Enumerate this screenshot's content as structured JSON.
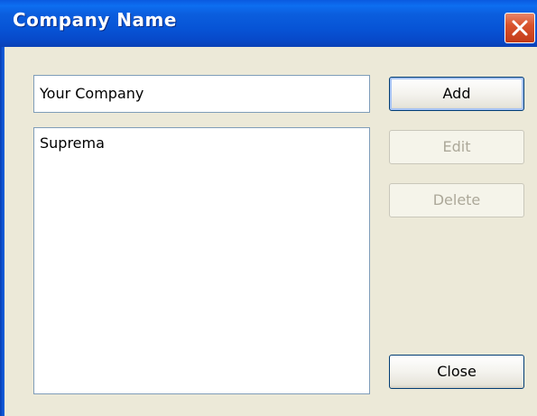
{
  "window": {
    "title": "Company Name",
    "close_icon": "close-icon"
  },
  "input": {
    "value": "Your Company"
  },
  "list": {
    "items": [
      "Suprema"
    ]
  },
  "buttons": {
    "add": "Add",
    "edit": "Edit",
    "delete": "Delete",
    "close": "Close"
  },
  "colors": {
    "titlebar": "#0754d6",
    "close_button": "#d9532c",
    "window_background": "#ece9d8",
    "disabled_text": "#aca899"
  }
}
